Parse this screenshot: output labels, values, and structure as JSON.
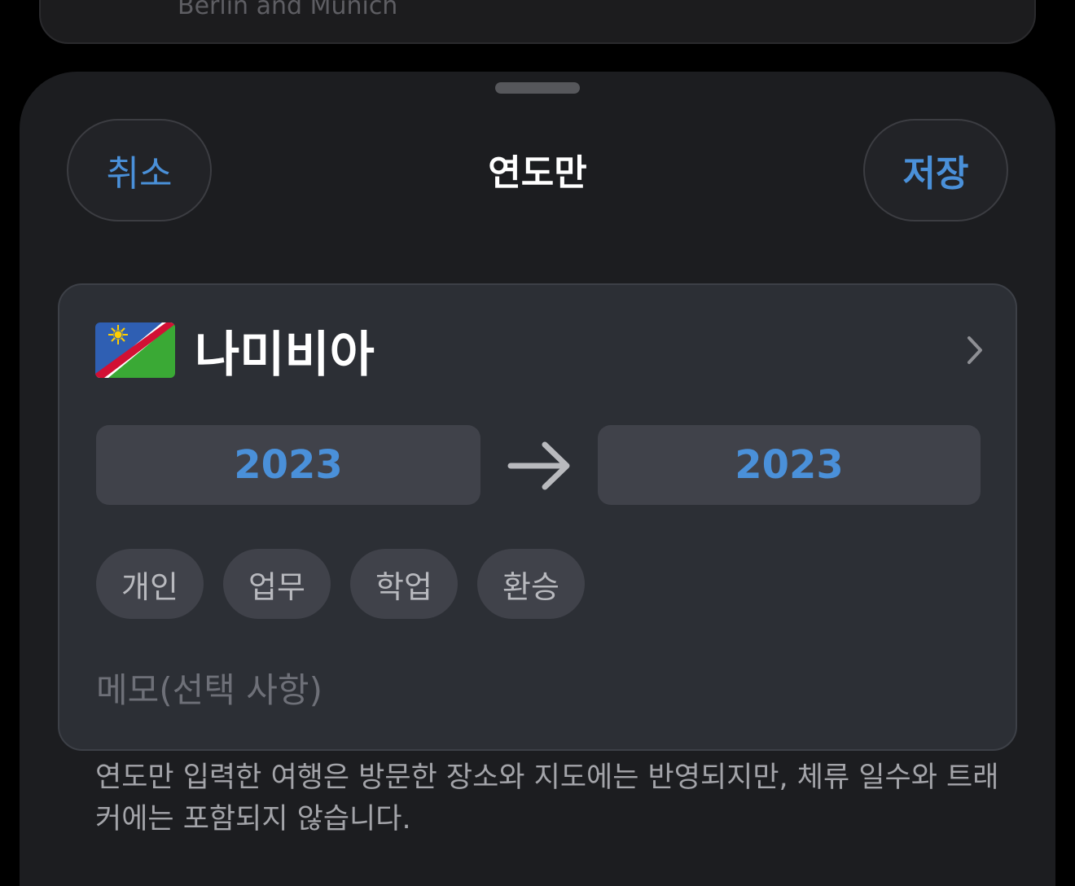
{
  "background_card": {
    "text": "Berlin and Munich"
  },
  "sheet": {
    "cancel_label": "취소",
    "title": "연도만",
    "save_label": "저장"
  },
  "trip": {
    "country": "나미비아",
    "start_year": "2023",
    "end_year": "2023",
    "tags": [
      "개인",
      "업무",
      "학업",
      "환승"
    ],
    "memo_placeholder": "메모(선택 사항)"
  },
  "footnote": "연도만 입력한 여행은 방문한 장소와 지도에는 반영되지만, 체류 일수와 트래커에는 포함되지 않습니다.",
  "colors": {
    "accent": "#4a90d9",
    "sheet_bg": "#1c1d20",
    "card_bg": "#2c2f35"
  },
  "icons": {
    "flag": "namibia-flag-icon",
    "chevron": "chevron-right-icon",
    "arrow": "arrow-right-icon"
  }
}
